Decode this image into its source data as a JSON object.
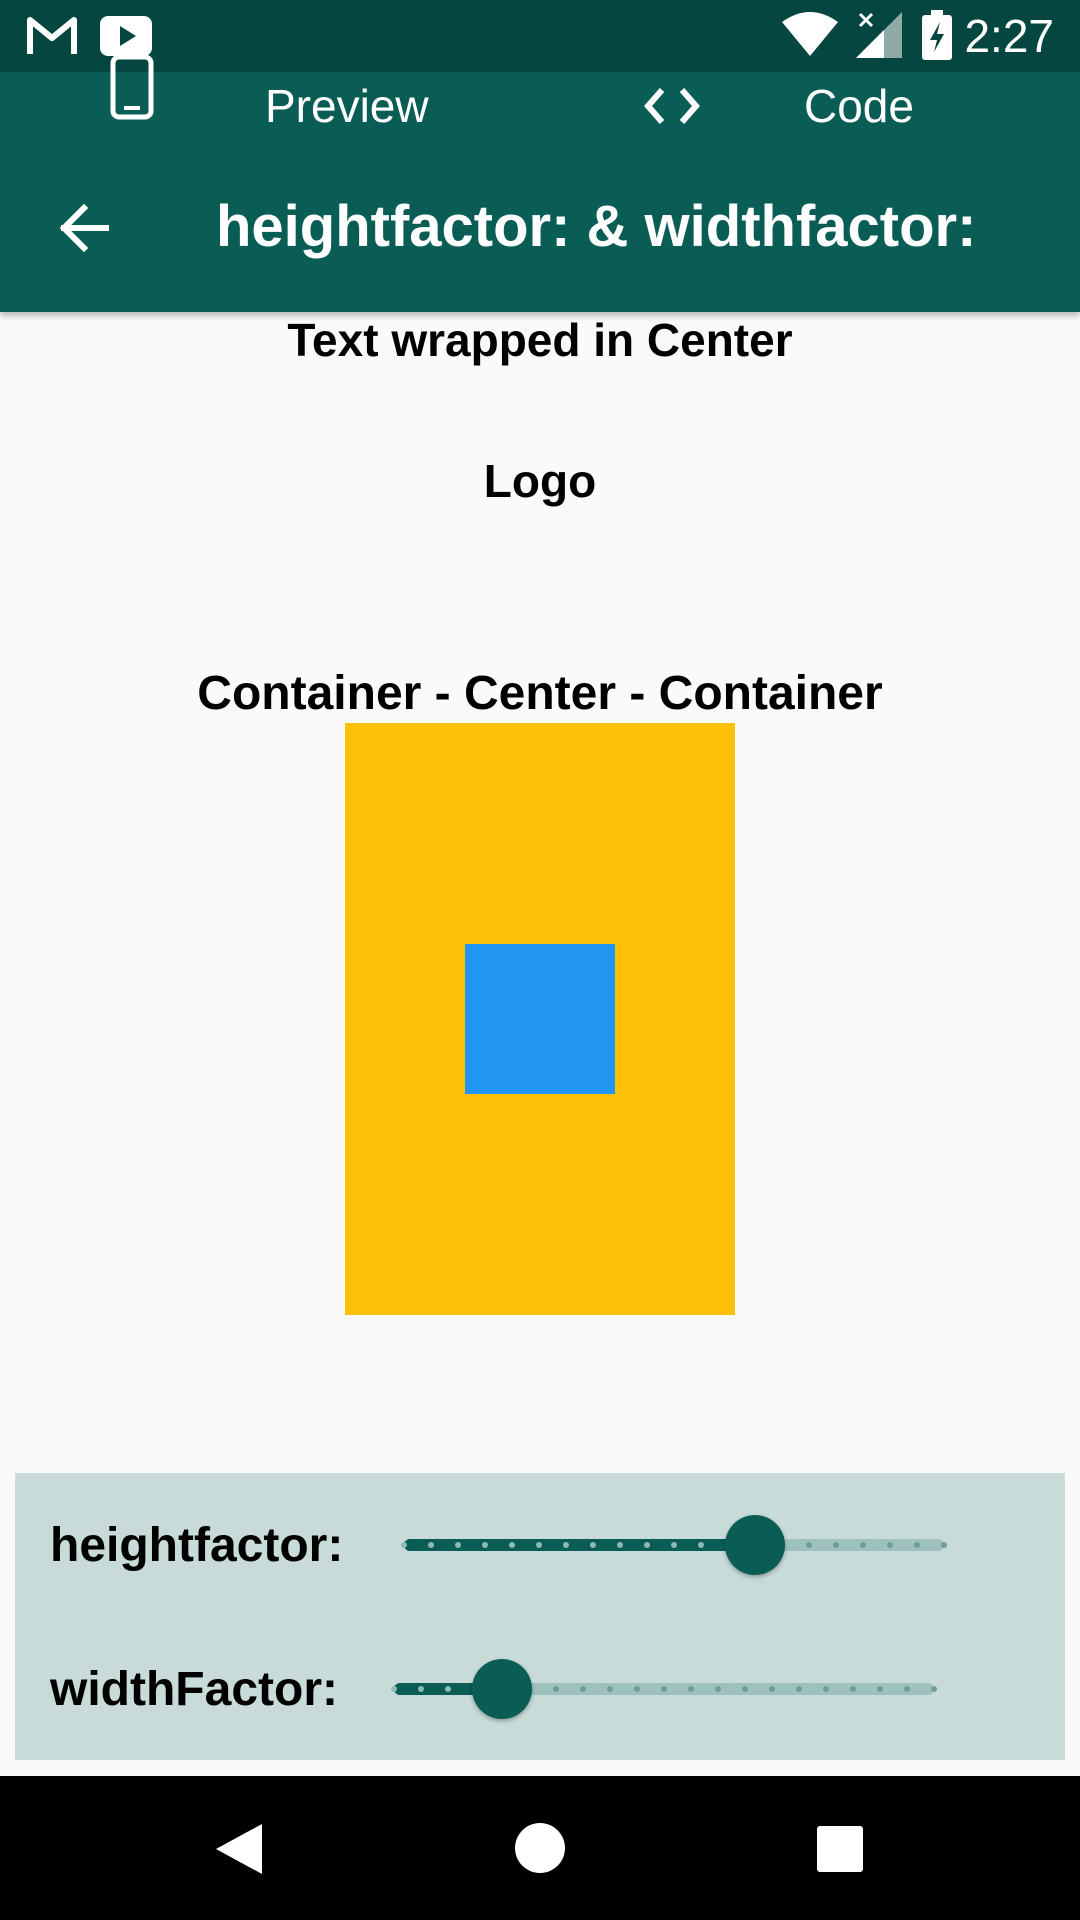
{
  "status_bar": {
    "time": "2:27",
    "icons": [
      "gmail-icon",
      "youtube-icon",
      "wifi-icon",
      "signal-icon",
      "battery-icon"
    ]
  },
  "tabs": {
    "preview_label": "Preview",
    "code_label": "Code",
    "preview_icon": "phone-icon",
    "code_icon": "code-brackets-icon"
  },
  "app_bar": {
    "title": "heightfactor: & widthfactor:",
    "back_icon": "arrow-left-icon"
  },
  "content": {
    "heading_center": "Text wrapped in Center",
    "logo_text": "Logo",
    "container_heading": "Container - Center - Container"
  },
  "controls": {
    "height_label": "heightfactor:",
    "width_label": "widthFactor:",
    "height_slider": {
      "divisions": 20,
      "value_fraction": 0.65
    },
    "width_slider": {
      "divisions": 20,
      "value_fraction": 0.2
    }
  },
  "colors": {
    "primary": "#0A5D55",
    "primary_dark": "#064640",
    "outer_container": "#FFC107",
    "inner_container": "#2196F3",
    "controls_background": "#C8DBD9",
    "slider_inactive": "#9FC1BD"
  },
  "nav_bar": {
    "icons": [
      "back-triangle-icon",
      "home-circle-icon",
      "recents-square-icon"
    ]
  }
}
